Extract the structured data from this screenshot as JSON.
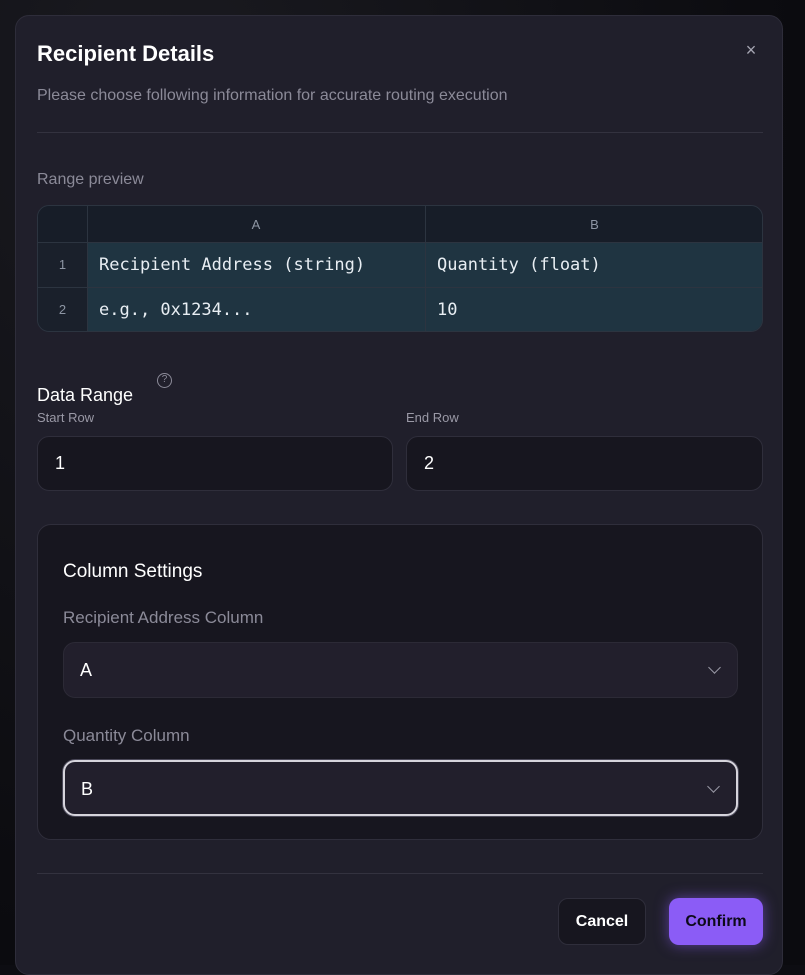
{
  "modal": {
    "title": "Recipient Details",
    "subtitle": "Please choose following information for accurate routing execution",
    "close_icon": "×"
  },
  "preview": {
    "label": "Range preview",
    "columns": [
      "A",
      "B"
    ],
    "rows": [
      {
        "num": "1",
        "cells": [
          "Recipient Address (string)",
          "Quantity (float)"
        ]
      },
      {
        "num": "2",
        "cells": [
          "e.g., 0x1234...",
          "10"
        ]
      }
    ]
  },
  "data_range": {
    "title": "Data Range",
    "help_icon": "?",
    "start_label": "Start Row",
    "start_value": "1",
    "end_label": "End Row",
    "end_value": "2"
  },
  "column_settings": {
    "title": "Column Settings",
    "address_label": "Recipient Address Column",
    "address_value": "A",
    "quantity_label": "Quantity Column",
    "quantity_value": "B"
  },
  "footer": {
    "cancel_label": "Cancel",
    "confirm_label": "Confirm"
  },
  "colors": {
    "accent": "#8b5cf6",
    "modal_bg": "#201f2b",
    "preview_row": "#1f3441"
  }
}
